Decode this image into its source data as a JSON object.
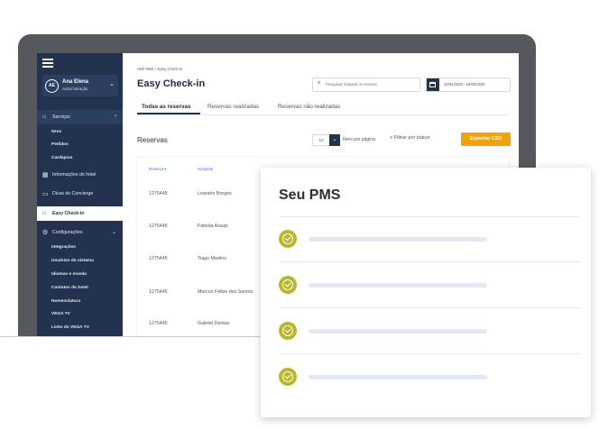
{
  "sidebar": {
    "user": {
      "initials": "AE",
      "name": "Ana Elena",
      "role": "Administração"
    },
    "items": [
      {
        "label": "Serviços",
        "icon": "shopping-bag-icon"
      },
      {
        "label": "Informações do hotel",
        "icon": "building-icon"
      },
      {
        "label": "Dicas do Concierge",
        "icon": "chat-icon"
      },
      {
        "label": "Easy Check-in",
        "icon": "bell-icon"
      },
      {
        "label": "Configurações",
        "icon": "gear-icon"
      }
    ],
    "servicos_sub": [
      "Itens",
      "Pedidos",
      "Cardápios"
    ],
    "config_sub": [
      "Integrações",
      "Usuários do sistema",
      "Idiomas e moeda",
      "Contatos do hotel",
      "Nomenclatura",
      "VEGA TV",
      "Links do VEGA TV"
    ]
  },
  "header": {
    "breadcrumb": "HSP Web > Easy Check-in",
    "title": "Easy Check-in",
    "search_placeholder": "Pesquisar hóspede ou reserva",
    "date_range": "10/04/2020 - 16/06/2020"
  },
  "tabs": [
    "Todas as reservas",
    "Reservas realizadas",
    "Reservas não realizadas"
  ],
  "reservas": {
    "heading": "Reservas",
    "per_page_value": "10",
    "per_page_label": "Itens por página",
    "filter_label": "Filtrar por status",
    "export_label": "Exportar CSV",
    "columns": [
      "Reserva ▾",
      "Hóspede"
    ],
    "rows": [
      {
        "reserva": "1275445",
        "hospede": "Leandro Borges"
      },
      {
        "reserva": "1275445",
        "hospede": "Fabiola Araujo"
      },
      {
        "reserva": "1275445",
        "hospede": "Tiago Martins"
      },
      {
        "reserva": "1275445",
        "hospede": "Marcos Felipe dos Santos"
      },
      {
        "reserva": "1275445",
        "hospede": "Gabriel Dantas"
      }
    ]
  },
  "pms_card": {
    "title": "Seu PMS",
    "items_count_label": ""
  },
  "colors": {
    "sidebar": "#23324e",
    "accent_orange": "#f2a20a",
    "check_olive": "#b6b82a",
    "placeholder_bar": "#e3e7f6"
  }
}
